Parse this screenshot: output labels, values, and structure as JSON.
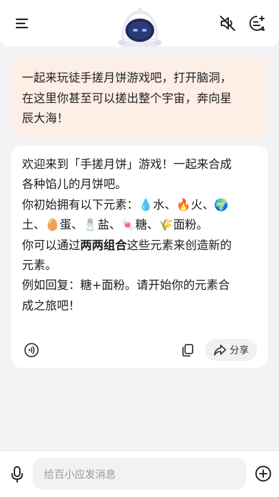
{
  "header": {
    "menu_icon": "menu-icon",
    "avatar_icon": "robot-avatar",
    "mute_icon": "speaker-muted-icon",
    "new_chat_icon": "new-chat-icon"
  },
  "user_message": {
    "line1": "一起来玩徒手搓月饼游戏吧，打开脑洞，",
    "line2": "在这里你甚至可以搓出整个宇宙，奔向星",
    "line3": "辰大海！"
  },
  "bot_message": {
    "line1": "欢迎来到「手搓月饼」游戏！一起来合成",
    "line2": "各种馅儿的月饼吧。",
    "line3_prefix": "你初始拥有以下元素：",
    "el_water_emoji": "💧",
    "el_water": "水、",
    "el_fire_emoji": "🔥",
    "el_fire": "火、",
    "el_earth_emoji": "🌍",
    "el_earth": "土、",
    "el_egg_emoji": "🥚",
    "el_egg": "蛋、",
    "el_salt_emoji": "🧂",
    "el_salt": "盐、",
    "el_sugar_emoji": "🍬",
    "el_sugar": "糖、",
    "el_flour_emoji": "🌾",
    "el_flour": "面粉。",
    "line5_prefix": "你可以通过",
    "line5_bold": "两两组合",
    "line5_suffix": "这些元素来创造新的",
    "line6": "元素。",
    "line7": "例如回复：糖+面粉。请开始你的元素合",
    "line8": "成之旅吧！",
    "share_label": "分享",
    "play_icon": "voice-play-icon",
    "copy_icon": "copy-icon",
    "share_icon": "share-icon"
  },
  "input": {
    "placeholder": "给百小应发消息",
    "mic_icon": "microphone-icon",
    "add_icon": "plus-circle-icon"
  }
}
